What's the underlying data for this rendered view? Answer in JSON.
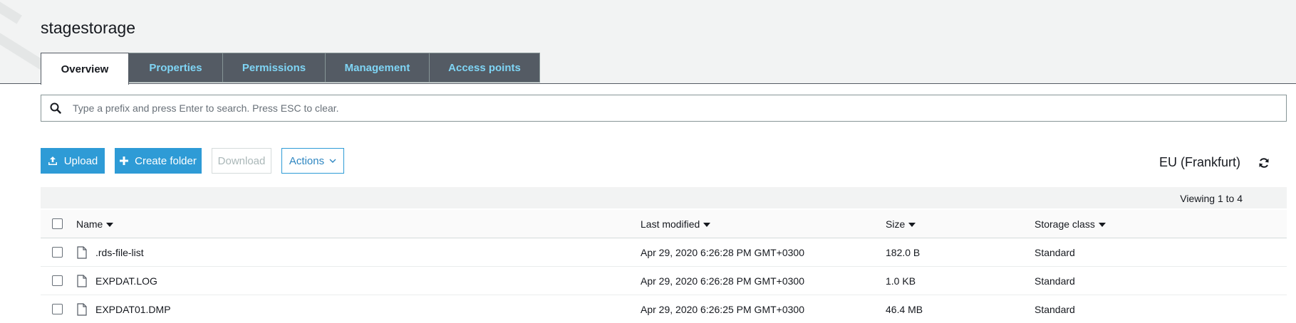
{
  "bucket": {
    "name": "stagestorage"
  },
  "tabs": [
    {
      "label": "Overview",
      "active": true
    },
    {
      "label": "Properties",
      "active": false
    },
    {
      "label": "Permissions",
      "active": false
    },
    {
      "label": "Management",
      "active": false
    },
    {
      "label": "Access points",
      "active": false
    }
  ],
  "search": {
    "placeholder": "Type a prefix and press Enter to search. Press ESC to clear.",
    "value": ""
  },
  "toolbar": {
    "upload_label": "Upload",
    "create_folder_label": "Create folder",
    "download_label": "Download",
    "actions_label": "Actions"
  },
  "region": {
    "label": "EU (Frankfurt)"
  },
  "viewing": {
    "text": "Viewing 1 to 4"
  },
  "table": {
    "columns": [
      {
        "label": "Name"
      },
      {
        "label": "Last modified"
      },
      {
        "label": "Size"
      },
      {
        "label": "Storage class"
      }
    ],
    "rows": [
      {
        "name": ".rds-file-list",
        "last_modified": "Apr 29, 2020 6:26:28 PM GMT+0300",
        "size": "182.0 B",
        "storage_class": "Standard"
      },
      {
        "name": "EXPDAT.LOG",
        "last_modified": "Apr 29, 2020 6:26:28 PM GMT+0300",
        "size": "1.0 KB",
        "storage_class": "Standard"
      },
      {
        "name": "EXPDAT01.DMP",
        "last_modified": "Apr 29, 2020 6:26:25 PM GMT+0300",
        "size": "46.4 MB",
        "storage_class": "Standard"
      }
    ]
  },
  "colors": {
    "primary": "#2e9bd6",
    "tab_inactive_bg": "#545b64",
    "tab_inactive_text": "#7fd5f5",
    "header_bg": "#f2f3f3"
  },
  "icons": {
    "search": "search-icon",
    "upload": "upload-icon",
    "create_folder": "plus-icon",
    "actions": "chevron-down-icon",
    "refresh": "refresh-icon",
    "file": "file-icon",
    "sort": "caret-down-icon"
  }
}
